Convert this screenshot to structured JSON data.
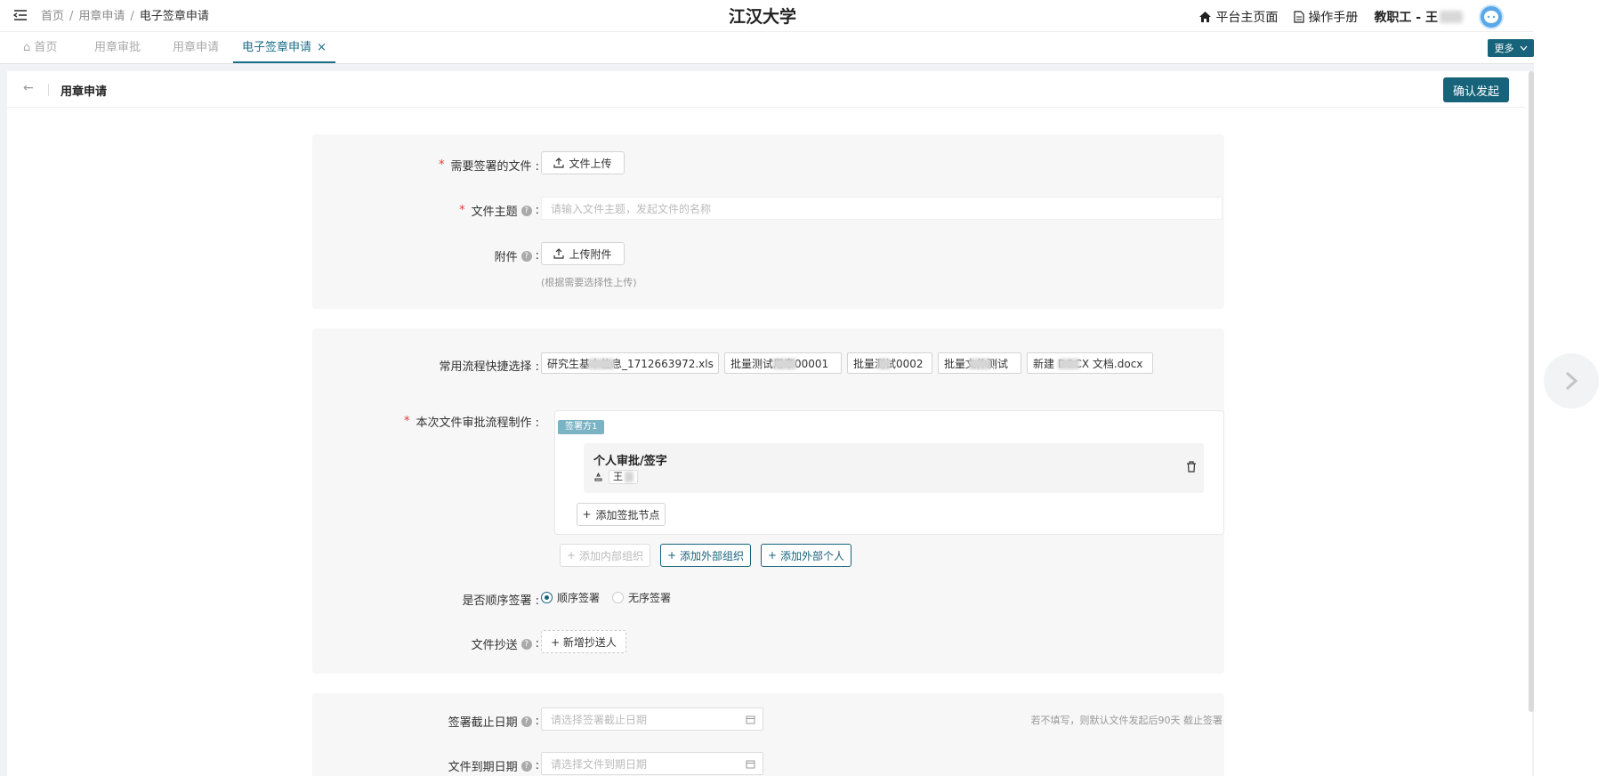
{
  "breadcrumb": {
    "home": "首页",
    "level2": "用章申请",
    "current": "电子签章申请"
  },
  "site_title": "江汉大学",
  "header_links": {
    "platform": "平台主页面",
    "manual": "操作手册",
    "user_role": "教职工 - 王"
  },
  "tabs": [
    {
      "label": "首页"
    },
    {
      "label": "用章审批"
    },
    {
      "label": "用章申请"
    },
    {
      "label": "电子签章申请",
      "close": "×"
    }
  ],
  "more_label": "更多",
  "page": {
    "title": "用章申请",
    "confirm_label": "确认发起"
  },
  "section1": {
    "file_label": "需要签署的文件 :",
    "upload_label": "文件上传",
    "subject_label": "文件主题",
    "subject_placeholder": "请输入文件主题，发起文件的名称",
    "attachment_label": "附件",
    "attachment_upload": "上传附件",
    "attachment_hint": "(根据需要选择性上传)"
  },
  "section2": {
    "quick_label": "常用流程快捷选择 :",
    "quick_items": [
      "研究生基本信息_1712663972.xls",
      "批量测试用章00001",
      "批量测试0002",
      "批量文件测试",
      "新建 DOCX 文档.docx"
    ],
    "flow_label": "本次文件审批流程制作 :",
    "party_tag": "签署方1",
    "node_title": "个人审批/签字",
    "node_user": "王",
    "add_node": "添加签批节点",
    "add_internal": "添加内部组织",
    "add_external_org": "添加外部组织",
    "add_external_person": "添加外部个人",
    "sequence_label": "是否顺序签署 :",
    "sequence_options": [
      "顺序签署",
      "无序签署"
    ],
    "cc_label": "文件抄送",
    "cc_button": "+ 新增抄送人"
  },
  "section3": {
    "deadline_label": "签署截止日期",
    "deadline_placeholder": "请选择签署截止日期",
    "deadline_hint": "若不填写，则默认文件发起后90天 截止签署",
    "expire_label": "文件到期日期",
    "expire_placeholder": "请选择文件到期日期"
  },
  "colors": {
    "primary": "#17637a",
    "required": "#e33333"
  }
}
